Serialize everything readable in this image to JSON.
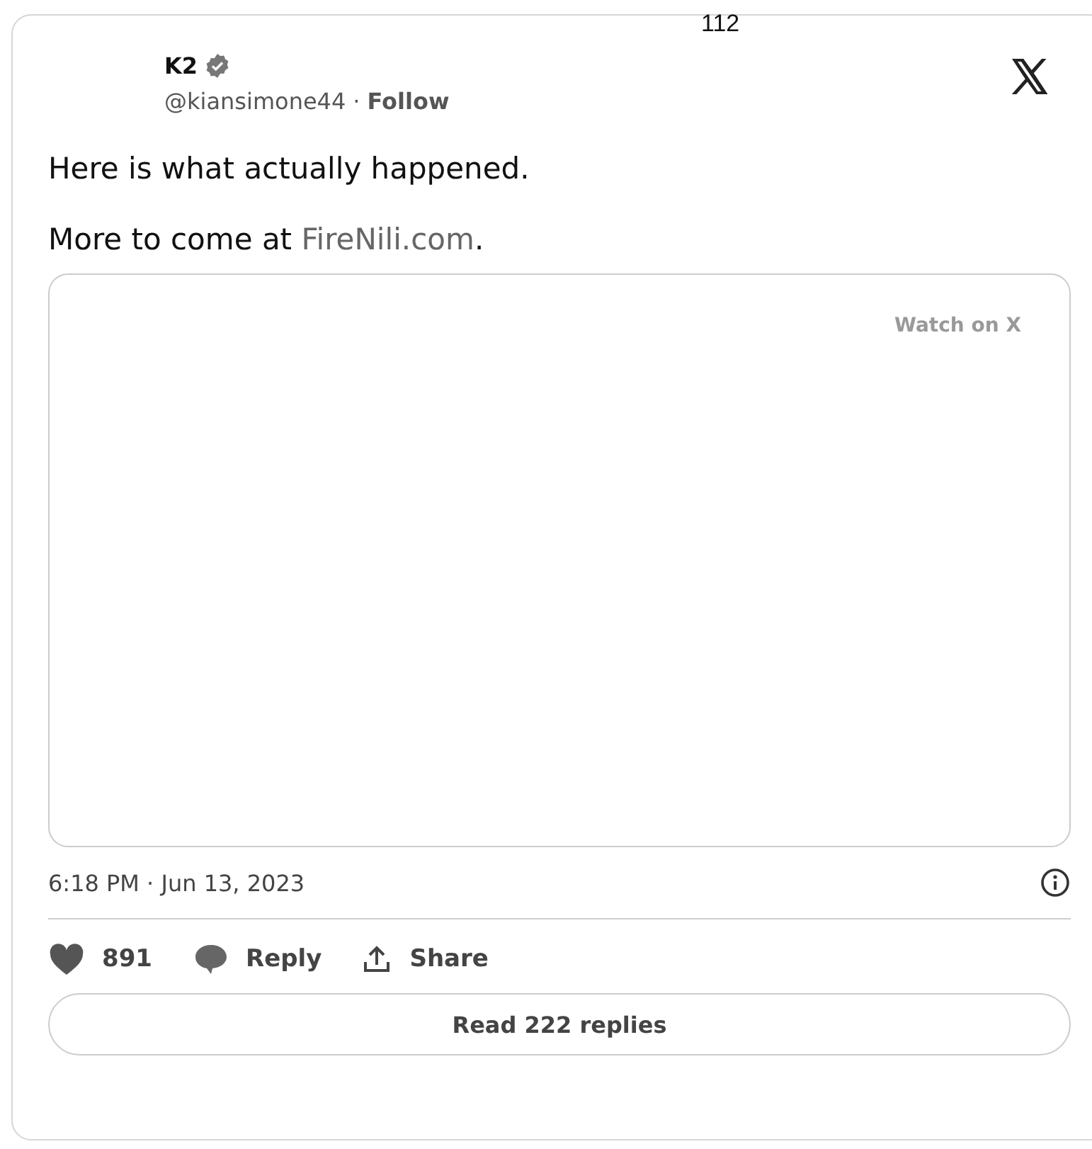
{
  "page_number": "112",
  "author": {
    "name": "K2",
    "verified": true,
    "handle": "@kiansimone44",
    "separator": "·",
    "follow": "Follow"
  },
  "text": {
    "lines": [
      "Here is what actually happened."
    ],
    "link_prefix": "More to come at ",
    "link": "FireNili.com",
    "link_suffix": "."
  },
  "media": {
    "watch_label": "Watch on X"
  },
  "timestamp": "6:18 PM · Jun 13, 2023",
  "actions": [
    {
      "kind": "like",
      "label": "891"
    },
    {
      "kind": "reply",
      "label": "Reply"
    },
    {
      "kind": "share",
      "label": "Share"
    }
  ],
  "read_replies": "Read 222 replies"
}
